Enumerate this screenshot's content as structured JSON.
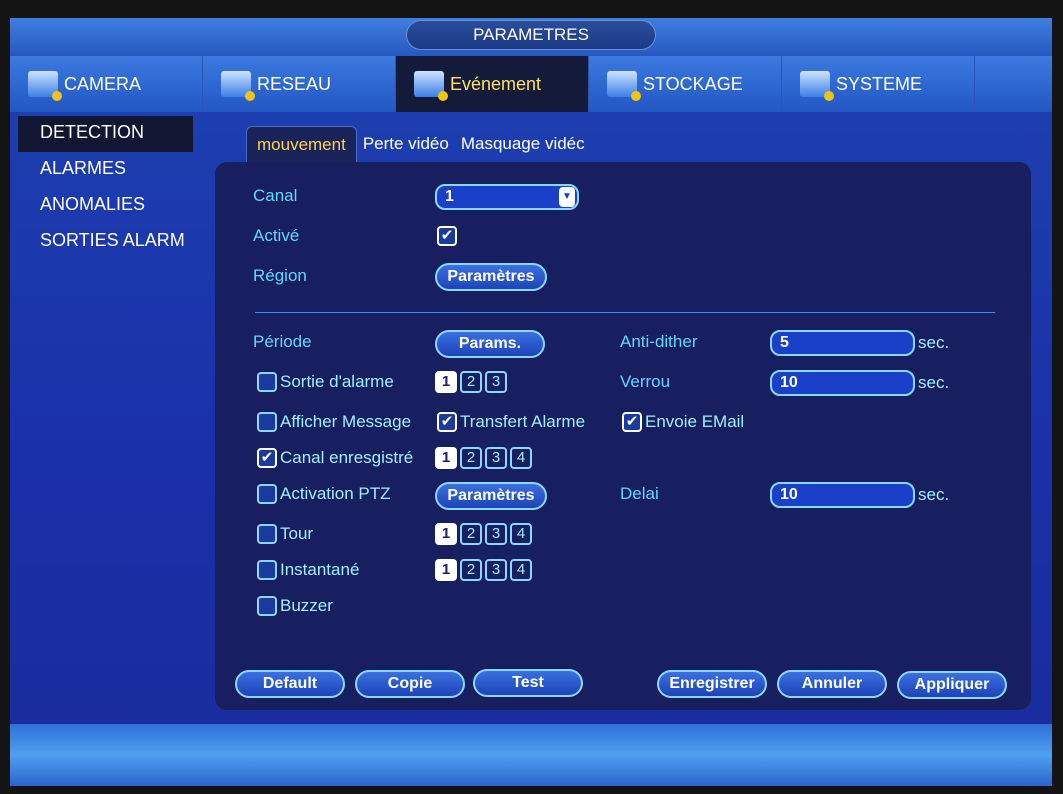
{
  "title": "PARAMETRES",
  "tabs": [
    {
      "label": "CAMERA",
      "icon": "camera-icon"
    },
    {
      "label": "RESEAU",
      "icon": "network-icon"
    },
    {
      "label": "Evénement",
      "icon": "event-icon"
    },
    {
      "label": "STOCKAGE",
      "icon": "storage-icon"
    },
    {
      "label": "SYSTEME",
      "icon": "system-icon"
    }
  ],
  "active_tab": "Evénement",
  "sidebar": [
    "DETECTION",
    "ALARMES",
    "ANOMALIES",
    "SORTIES ALARM"
  ],
  "subtabs": [
    "mouvement",
    "Perte vidéo",
    "Masquage vidéc"
  ],
  "form": {
    "canal_label": "Canal",
    "canal_value": "1",
    "active_label": "Activé",
    "active_checked": true,
    "region_label": "Région",
    "region_button": "Paramètres",
    "periode_label": "Période",
    "periode_button": "Params.",
    "antidither_label": "Anti-dither",
    "antidither_value": "5",
    "antidither_unit": "sec.",
    "verrou_label": "Verrou",
    "verrou_value": "10",
    "verrou_unit": "sec.",
    "delai_label": "Delai",
    "delai_value": "10",
    "delai_unit": "sec.",
    "sortie_label": "Sortie d'alarme",
    "sortie_checked": false,
    "sortie_channels": [
      "1",
      "2",
      "3"
    ],
    "afficher_label": "Afficher Message",
    "afficher_checked": false,
    "transfert_label": "Transfert Alarme",
    "transfert_checked": true,
    "email_label": "Envoie EMail",
    "email_checked": true,
    "canal_enr_label": "Canal enresgistré",
    "canal_enr_checked": true,
    "canal_enr_channels": [
      "1",
      "2",
      "3",
      "4"
    ],
    "ptz_label": "Activation PTZ",
    "ptz_checked": false,
    "ptz_button": "Paramètres",
    "tour_label": "Tour",
    "tour_checked": false,
    "tour_channels": [
      "1",
      "2",
      "3",
      "4"
    ],
    "instantane_label": "Instantané",
    "instantane_checked": false,
    "instantane_channels": [
      "1",
      "2",
      "3",
      "4"
    ],
    "buzzer_label": "Buzzer",
    "buzzer_checked": false,
    "selected_channel": "1"
  },
  "buttons": {
    "default": "Default",
    "copie": "Copie",
    "test": "Test",
    "enregistrer": "Enregistrer",
    "annuler": "Annuler",
    "appliquer": "Appliquer"
  },
  "check_glyph": "✔"
}
